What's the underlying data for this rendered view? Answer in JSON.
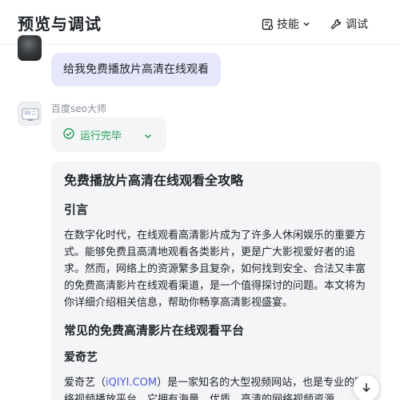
{
  "header": {
    "title": "预览与调试",
    "skills_label": "技能",
    "debug_label": "调试"
  },
  "conversation": {
    "user_message": "给我免费播放片高清在线观看",
    "bot_name": "百度seo大师",
    "status_text": "运行完毕",
    "answer": {
      "title": "免费播放片高清在线观看全攻略",
      "intro_heading": "引言",
      "intro_text": "在数字化时代，在线观看高清影片成为了许多人休闲娱乐的重要方式。能够免费且高清地观看各类影片，更是广大影视爱好者的追求。然而，网络上的资源繁多且复杂，如何找到安全、合法又丰富的免费高清影片在线观看渠道，是一个值得探讨的问题。本文将为你详细介绍相关信息，帮助你畅享高清影视盛宴。",
      "section_heading": "常见的免费高清影片在线观看平台",
      "platform_name": "爱奇艺",
      "platform_text_before": "爱奇艺（",
      "platform_link": "iQIYI.COM",
      "platform_text_after": "）是一家知名的大型视频网站，也是专业的网络视频播放平台。它拥有海量、优质、高清的网络视频资源，"
    }
  },
  "icons": {
    "skills": "puzzle-card-icon",
    "chevron": "chevron-down-icon",
    "debug": "wrench-icon",
    "status": "check-circle-icon",
    "scroll": "arrow-down-icon"
  },
  "colors": {
    "user_bubble": "#e6e7fb",
    "card_bg": "#f4f5f7",
    "status_green": "#1f9d55",
    "link": "#4b5bd6"
  }
}
